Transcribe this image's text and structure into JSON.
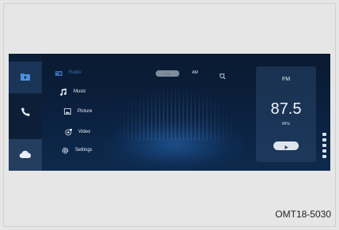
{
  "sidebar": {
    "items": [
      {
        "icon": "media-folder-icon",
        "active": true
      },
      {
        "icon": "phone-icon",
        "active": false
      },
      {
        "icon": "cloud-icon",
        "active": false
      }
    ]
  },
  "menu": {
    "items": [
      {
        "label": "Radio",
        "icon": "radio-icon"
      },
      {
        "label": "Music",
        "icon": "music-note-icon"
      },
      {
        "label": "Picture",
        "icon": "picture-icon"
      },
      {
        "label": "Video",
        "icon": "video-icon"
      },
      {
        "label": "Settings",
        "icon": "settings-icon"
      }
    ]
  },
  "top_controls": {
    "band_toggle_label": "FM",
    "am_label": "AM",
    "scan_icon": "search-radio-icon"
  },
  "now_playing": {
    "band": "FM",
    "frequency": "87.5",
    "unit": "MHz",
    "play_icon": "play-icon"
  },
  "status_icons": [
    "bluetooth-icon",
    "usb-icon",
    "volume-icon",
    "bluetooth-icon",
    "battery-icon"
  ],
  "caption": "OMT18-5030",
  "colors": {
    "screen_bg": "#0b2140",
    "accent": "#3a6fb2",
    "text": "#e8eef6"
  }
}
